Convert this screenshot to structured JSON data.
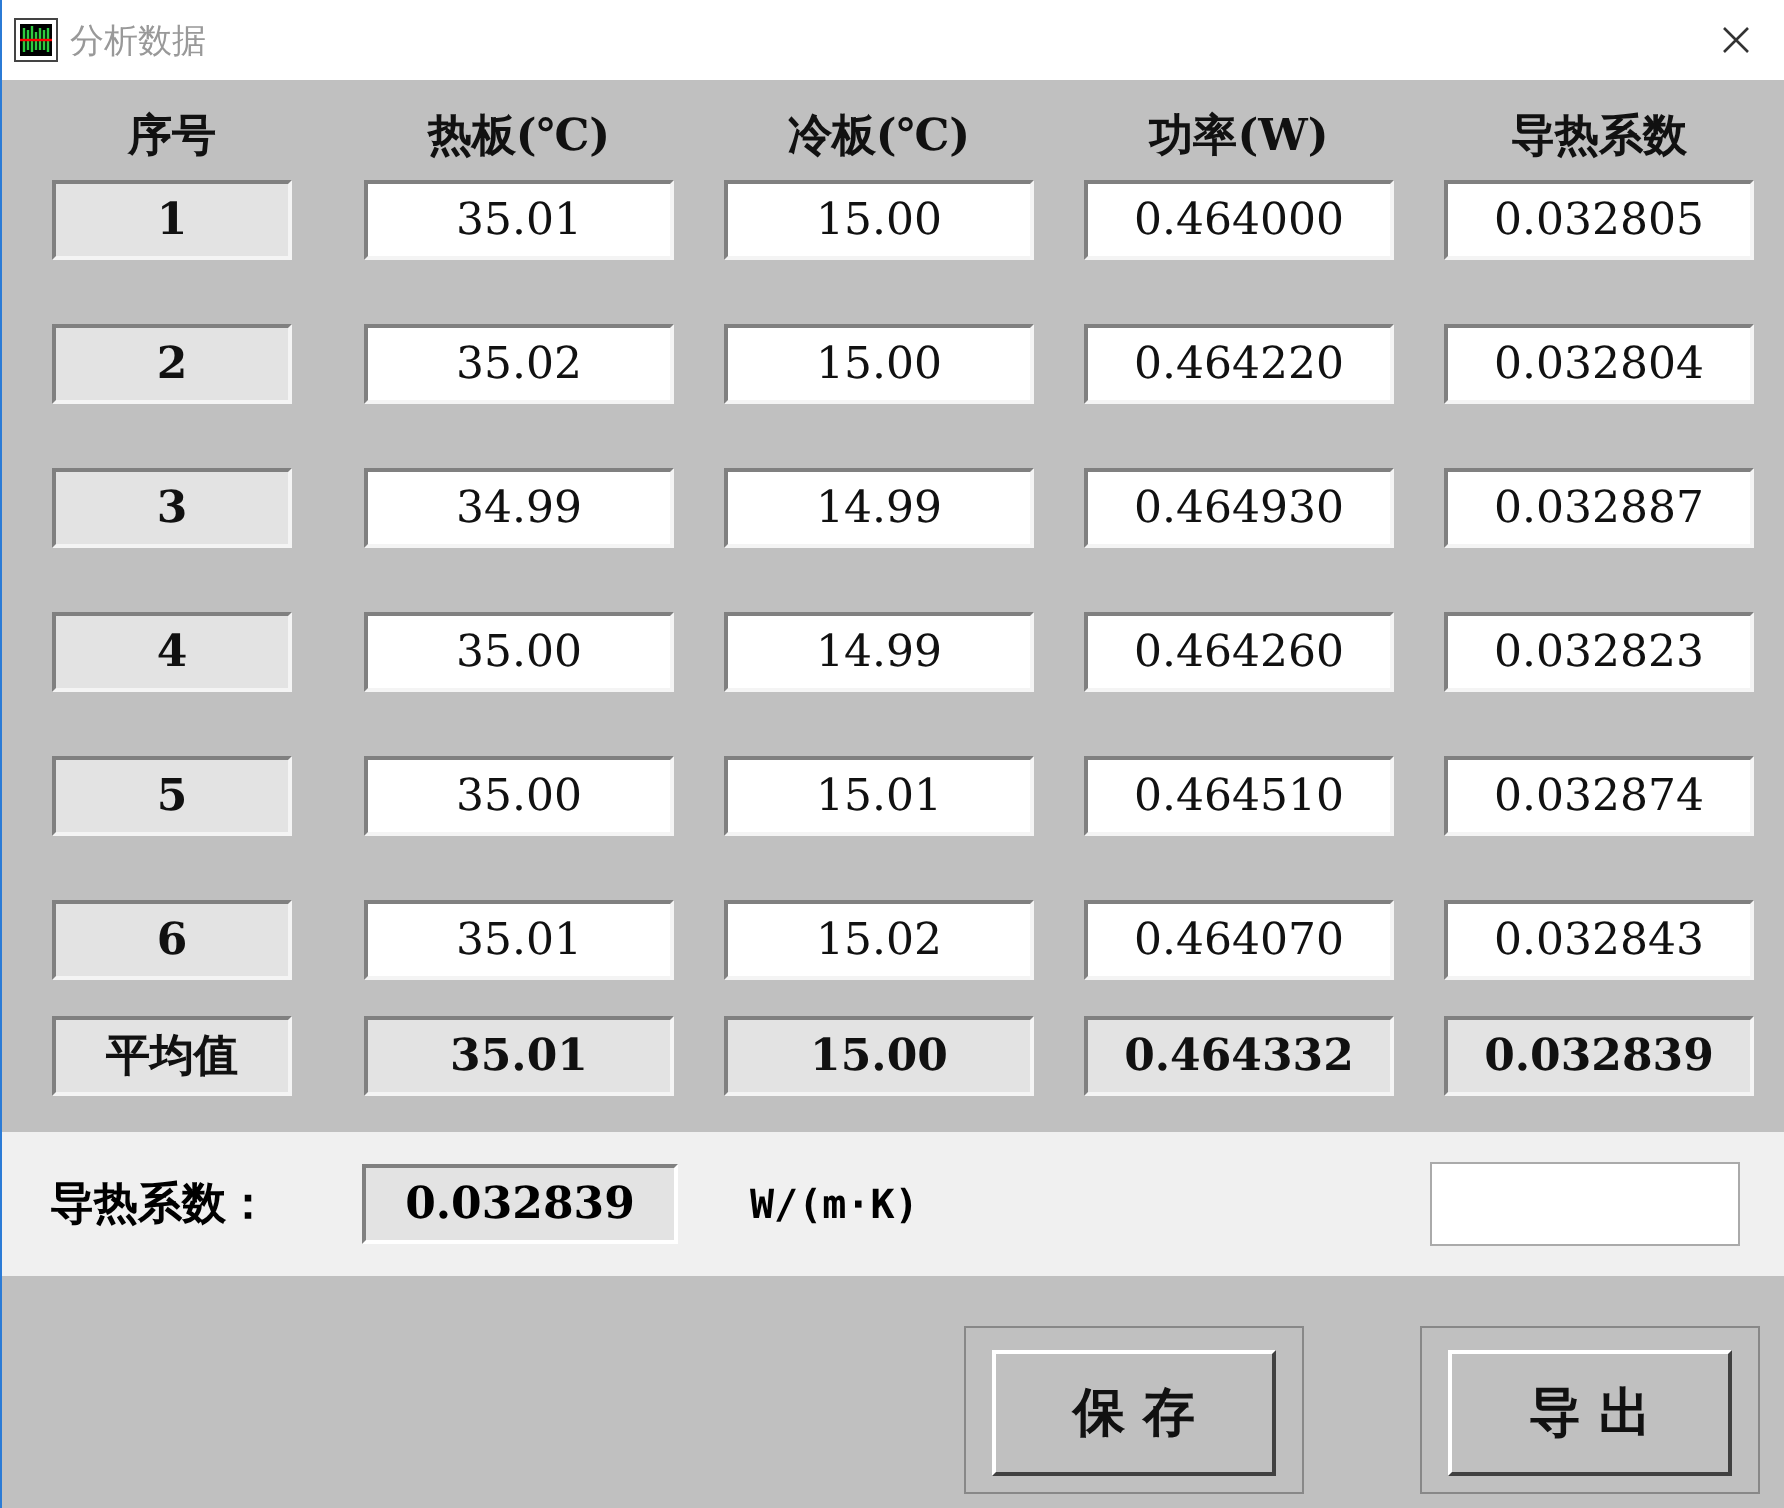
{
  "window": {
    "title": "分析数据"
  },
  "table": {
    "columns": [
      "序号",
      "热板(℃)",
      "冷板(℃)",
      "功率(W)",
      "导热系数"
    ],
    "rows": [
      {
        "index": "1",
        "values": [
          "35.01",
          "15.00",
          "0.464000",
          "0.032805"
        ]
      },
      {
        "index": "2",
        "values": [
          "35.02",
          "15.00",
          "0.464220",
          "0.032804"
        ]
      },
      {
        "index": "3",
        "values": [
          "34.99",
          "14.99",
          "0.464930",
          "0.032887"
        ]
      },
      {
        "index": "4",
        "values": [
          "35.00",
          "14.99",
          "0.464260",
          "0.032823"
        ]
      },
      {
        "index": "5",
        "values": [
          "35.00",
          "15.01",
          "0.464510",
          "0.032874"
        ]
      },
      {
        "index": "6",
        "values": [
          "35.01",
          "15.02",
          "0.464070",
          "0.032843"
        ]
      }
    ],
    "average": {
      "label": "平均值",
      "values": [
        "35.01",
        "15.00",
        "0.464332",
        "0.032839"
      ]
    }
  },
  "result": {
    "label": "导热系数：",
    "value": "0.032839",
    "unit": "W/(m·K)"
  },
  "buttons": [
    "保 存",
    "导 出"
  ]
}
